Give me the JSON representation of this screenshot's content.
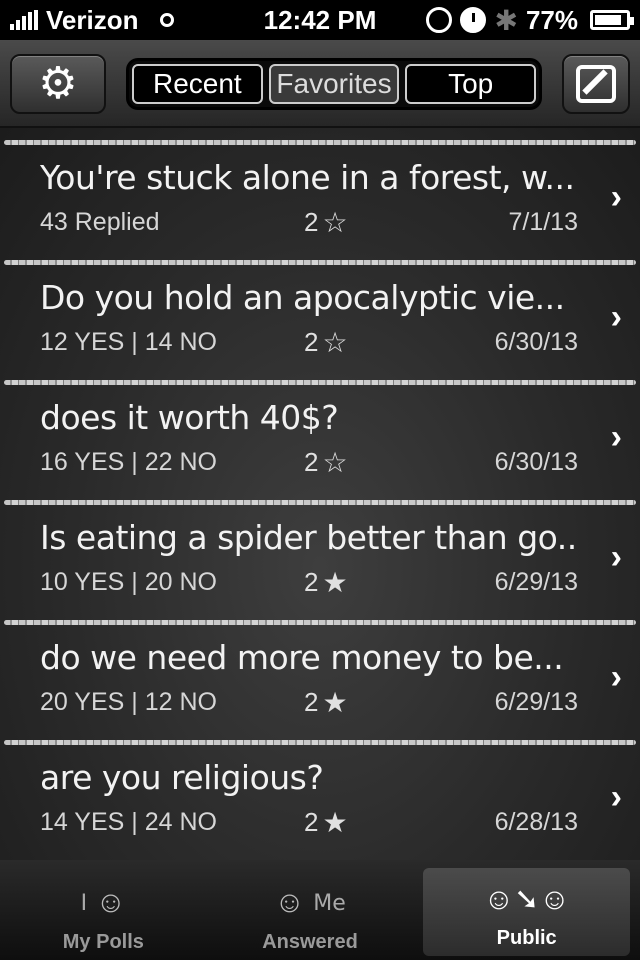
{
  "status_bar": {
    "carrier": "Verizon",
    "time": "12:42 PM",
    "battery": "77%"
  },
  "toolbar": {
    "segments": [
      "Recent",
      "Favorites",
      "Top"
    ],
    "active_segment": "Favorites"
  },
  "polls": [
    {
      "title": "You're stuck alone in a forest, w...",
      "stats": "43 Replied",
      "stars": "2",
      "star_filled": false,
      "date": "7/1/13"
    },
    {
      "title": "Do you hold an apocalyptic vie...",
      "stats": "12 YES | 14 NO",
      "stars": "2",
      "star_filled": false,
      "date": "6/30/13"
    },
    {
      "title": "does it worth 40$?",
      "stats": "16 YES | 22 NO",
      "stars": "2",
      "star_filled": false,
      "date": "6/30/13"
    },
    {
      "title": "Is eating a spider better than go...",
      "stats": "10 YES | 20 NO",
      "stars": "2",
      "star_filled": true,
      "date": "6/29/13"
    },
    {
      "title": "do we need more money to be...",
      "stats": "20 YES | 12 NO",
      "stars": "2",
      "star_filled": true,
      "date": "6/29/13"
    },
    {
      "title": "are you religious?",
      "stats": "14 YES | 24 NO",
      "stars": "2",
      "star_filled": true,
      "date": "6/28/13"
    }
  ],
  "tabbar": {
    "tabs": [
      {
        "label": "My Polls",
        "icon": "my-polls-icon",
        "mini": "I"
      },
      {
        "label": "Answered",
        "icon": "answered-icon",
        "mini": "Me"
      },
      {
        "label": "Public",
        "icon": "public-icon",
        "mini": ""
      }
    ],
    "active_tab": "Public"
  }
}
